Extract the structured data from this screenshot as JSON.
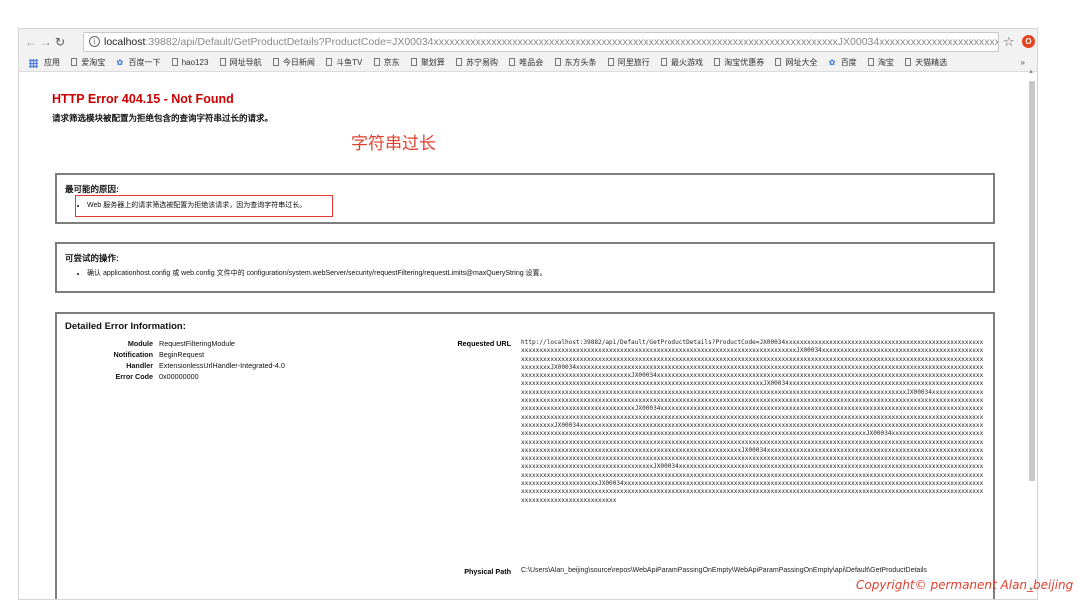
{
  "browser": {
    "url_host": "localhost",
    "url_rest": ":39882/api/Default/GetProductDetails?ProductCode=JX00034xxxxxxxxxxxxxxxxxxxxxxxxxxxxxxxxxxxxxxxxxxxxxxxxxxxxxxxxxxxxxxxxxxxxxxxxxxxxxJX00034xxxxxxxxxxxxxxxxxxxxxxxx..."
  },
  "bookmarks": {
    "items": [
      "应用",
      "爱淘宝",
      "百度一下",
      "hao123",
      "网址导航",
      "今日新闻",
      "斗鱼TV",
      "京东",
      "聚划算",
      "苏宁易购",
      "唯品会",
      "东方头条",
      "阿里旅行",
      "最火游戏",
      "淘宝优惠券",
      "网址大全",
      "百度",
      "淘宝",
      "天猫精选"
    ],
    "more": "»"
  },
  "page": {
    "error_title": "HTTP Error 404.15 - Not Found",
    "error_subtitle": "请求筛选模块被配置为拒绝包含的查询字符串过长的请求。",
    "annotation": "字符串过长",
    "causes_heading": "最可能的原因:",
    "cause_item": "Web 服务器上的请求筛选被配置为拒绝该请求，因为查询字符串过长。",
    "actions_heading": "可尝试的操作:",
    "action_item": "确认 applicationhost.config 或 web.config 文件中的 configuration/system.webServer/security/requestFiltering/requestLimits@maxQueryString 设置。",
    "detail_heading": "Detailed Error Information:",
    "details": [
      {
        "label": "Module",
        "value": "RequestFilteringModule"
      },
      {
        "label": "Notification",
        "value": "BeginRequest"
      },
      {
        "label": "Handler",
        "value": "ExtensionlessUrlHandler-Integrated-4.0"
      },
      {
        "label": "Error Code",
        "value": "0x00000000"
      }
    ],
    "requested_url_label": "Requested URL",
    "requested_url": "http://localhost:39882/api/Default/GetProductDetails?ProductCode=JX00034xxxxxxxxxxxxxxxxxxxxxxxxxxxxxxxxxxxxxxxxxxxxxxxxxxxxxxxxxxxxxxxxxxxxxxxxxxxxxxxxxxxxxxxxxxxxxxxxxxxxxxxxxxxxxxxxxxxxxxxxxxxxxxxxxJX00034xxxxxxxxxxxxxxxxxxxxxxxxxxxxxxxxxxxxxxxxxxxxxxxxxxxxxxxxxxxxxxxxxxxxxxxxxxxxxxxxxxxxxxxxxxxxxxxxxxxxxxxxxxxxxxxxxxxxxxxxxxxxxxxxxxxxxxxxxxxxxxxxxxxxxxxxxxxxxxxxxxxxxxxxxxxxxxxxxxJX00034xxxxxxxxxxxxxxxxxxxxxxxxxxxxxxxxxxxxxxxxxxxxxxxxxxxxxxxxxxxxxxxxxxxxxxxxxxxxxxxxxxxxxxxxxxxxxxxxxxxxxxxxxxxxxxxxxxxxxxxxxxxxxxxxxxxxxxxxxxxxxJX00034xxxxxxxxxxxxxxxxxxxxxxxxxxxxxxxxxxxxxxxxxxxxxxxxxxxxxxxxxxxxxxxxxxxxxxxxxxxxxxxxxxxxxxxxxxxxxxxxxxxxxxxxxxxxxxxxxxxxxxxxxxxxxxxxxxxxxxxxxxxxxxxxxxxxxxxxxxxJX00034xxxxxxxxxxxxxxxxxxxxxxxxxxxxxxxxxxxxxxxxxxxxxxxxxxxxxxxxxxxxxxxxxxxxxxxxxxxxxxxxxxxxxxxxxxxxxxxxxxxxxxxxxxxxxxxxxxxxxxxxxxxxxxxxxxxxxxxxxxxxxxxxxxxxxxxxxxxxxxJX00034xxxxxxxxxxxxxxxxxxxxxxxxxxxxxxxxxxxxxxxxxxxxxxxxxxxxxxxxxxxxxxxxxxxxxxxxxxxxxxxxxxxxxxxxxxxxxxxxxxxxxxxxxxxxxxxxxxxxxxxxxxxxxxxxxxxxxxxxxxxxxxxxxxxxxxxxxxxxxxxxxxxxxxxxxxxJX00034xxxxxxxxxxxxxxxxxxxxxxxxxxxxxxxxxxxxxxxxxxxxxxxxxxxxxxxxxxxxxxxxxxxxxxxxxxxxxxxxxxxxxxxxxxxxxxxxxxxxxxxxxxxxxxxxxxxxxxxxxxxxxxxxxxxxxxxxxxxxxxxxxxxxxxxxxxxxxxxxxxxxxxxxxxxxxxxxxxxxxxxxxxxxxxxxxxxxxxxxxxxxxxxxxxxxxxxxxxxxxxxJX00034xxxxxxxxxxxxxxxxxxxxxxxxxxxxxxxxxxxxxxxxxxxxxxxxxxxxxxxxxxxxxxxxxxxxxxxxxxxxxxxxxxxxxxxxxxxxxxxxxxxxxxxxxxxxxxxxxxxxxxxxxxxxxxxxxxxxxxxxxxxxxxxxxxxxxxxxxxxxxxxxxxxxxxxxxxxxxxxxxxxxxxxxxxxxxxxxxxxxxxxxxxxxJX00034xxxxxxxxxxxxxxxxxxxxxxxxxxxxxxxxxxxxxxxxxxxxxxxxxxxxxxxxxxxxxxxxxxxxxxxxxxxxxxxxxxxxxxxxxxxxxxxxxxxxxxxxxxxxxxxxxxxxxxxxxxxxxxxxxxxxxxxxxxxxxxxxxxxxxxxxxxxxxxxxxxxxxxxxxxxxxxxxxxxxxxxxxxxxxxxxxxxxxxxxxxxxxxxxxxxJX00034xxxxxxxxxxxxxxxxxxxxxxxxxxxxxxxxxxxxxxxxxxxxxxxxxxxxxxxxxxxxxxxxxxxxxxxxxxxxxxxxxxxxxxxxxxxxxxxxxxxxxxxxxxxxxxxxxxxxxxxxxxxxxxxxxxxxxxxxxxxxxxxxxxxxxxxxxxxxxxxxxxxxxxxxxxxxxxxxxxxxxxxxxxxxxxxxxxxxxxxxxxxxxxxxxxxxxxxxxxxxxJX00034xxxxxxxxxxxxxxxxxxxxxxxxxxxxxxxxxxxxxxxxxxxxxxxxxxxxxxxxxxxxxxxxxxxxxxxxxxxxxxxxxxxxxxxxxxxxxxxxxxxxxxxxxxxxxxxxxxxxxxxxxxxxxxxxxxxxxxxxxxxxxxxxxxxxxxxxxxxxxxxxxxxxxxxxxxxxxxxxxxxxxxxxxxxxxxxxxxxxxxxxxxxxxxxxxxxxxxxxxxxxxxxxxxxxxxJX00034xxxxxxxxxxxxxxxxxxxxxxxxxxxxxxxxxxxxxxxxxxxxxxxxxxxxxxxxxxxxxxxxxxxxxxxxxxxxxxxxxxxxxxxxxxxxxxxxxxxxxxxxxxxxxxxxxxxxxxxxxxxxxxxxxxxxxxxxxxxxxxxxxxxxxxxxxxxxxxxxxxxxxxxxxxxxxxxxxxxxxxxxxxxxxxxxxxxxxxxxxxxxxxxxxxxxxxxxxxxxxxxxxxxxxxxxxxxxxxxxxxxxxxxxxx",
    "physical_path_label": "Physical Path",
    "physical_path": "C:\\Users\\Alan_beijing\\source\\repos\\WebApiParamPassingOnEmpty\\WebApiParamPassingOnEmpty\\api\\Default\\GetProductDetails"
  },
  "watermark": "Copyright© permanent  Alan_beijing"
}
